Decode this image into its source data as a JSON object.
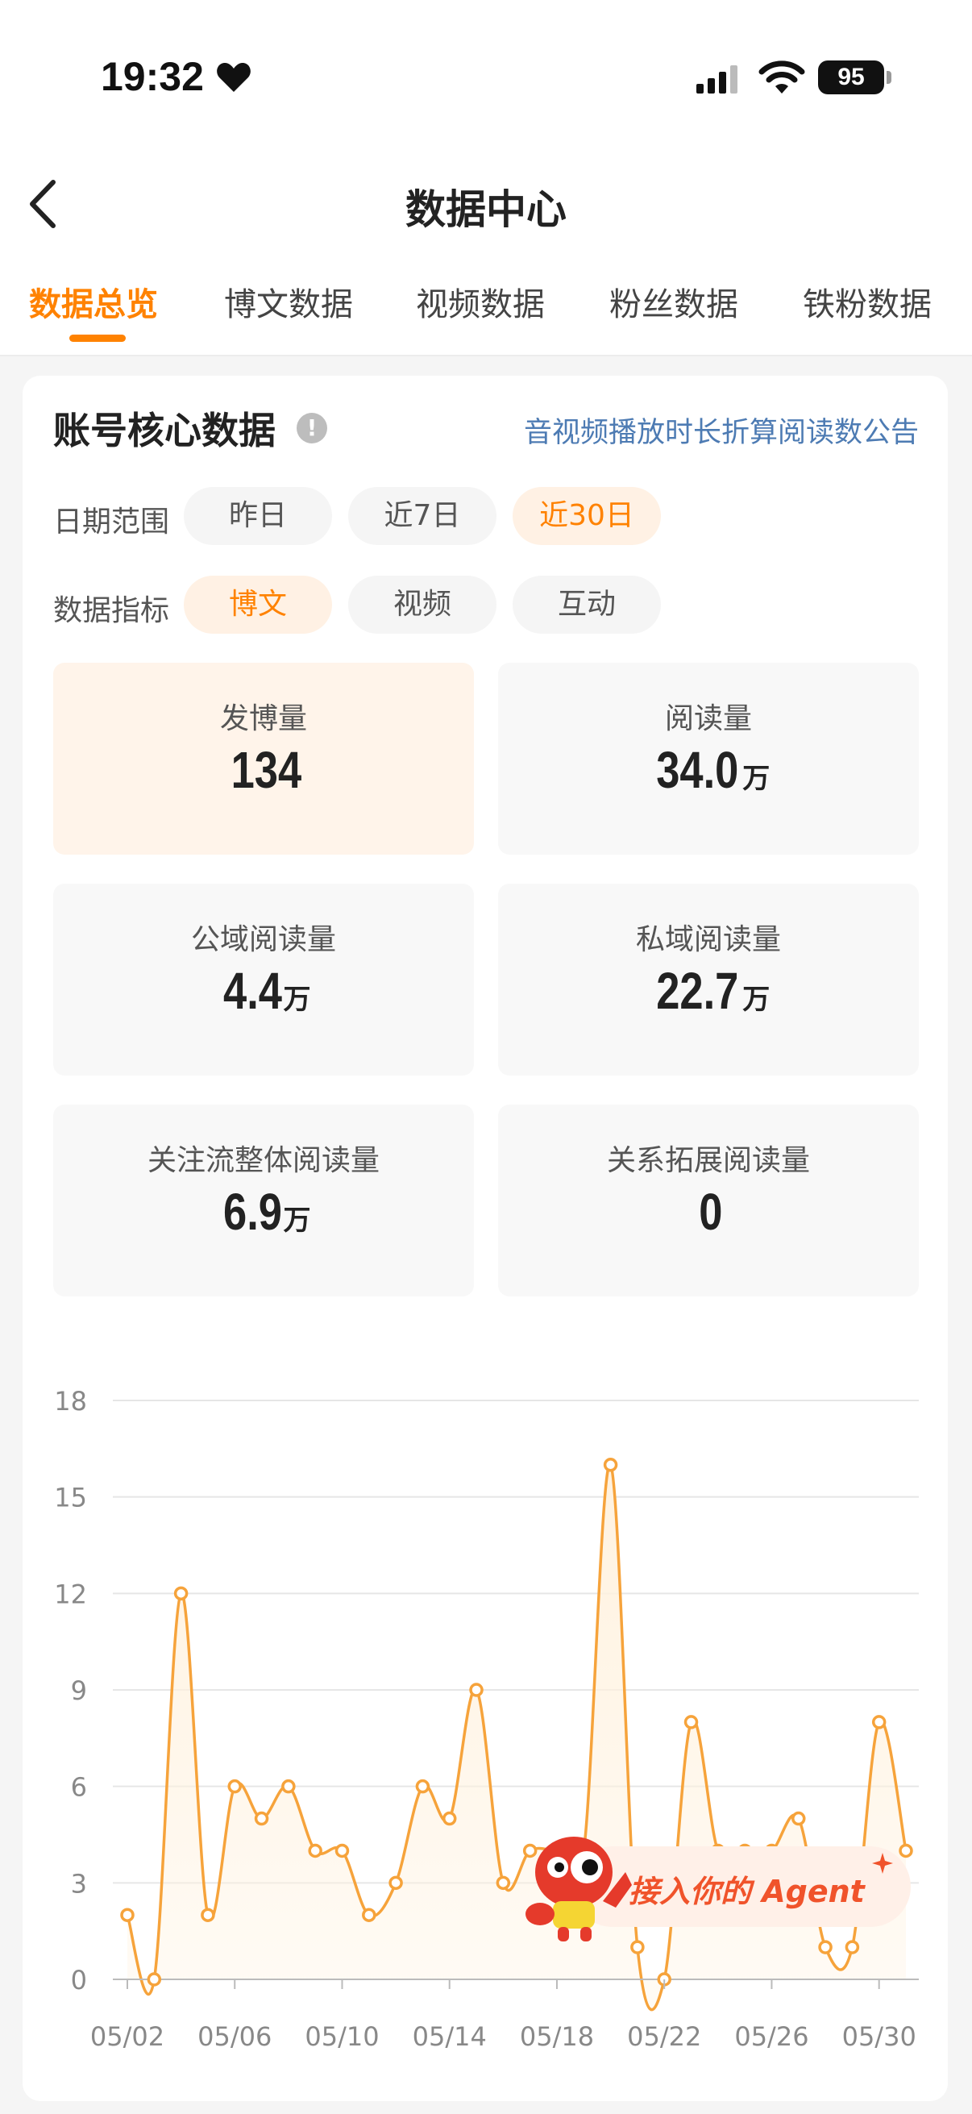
{
  "status_bar": {
    "time": "19:32",
    "battery": "95",
    "icons": [
      "heart-icon",
      "signal-icon",
      "wifi-icon",
      "battery-icon"
    ]
  },
  "header": {
    "title": "数据中心",
    "back_icon": "chevron-left-icon"
  },
  "tabs": [
    {
      "label": "数据总览",
      "active": true
    },
    {
      "label": "博文数据",
      "active": false
    },
    {
      "label": "视频数据",
      "active": false
    },
    {
      "label": "粉丝数据",
      "active": false
    },
    {
      "label": "铁粉数据",
      "active": false
    }
  ],
  "core": {
    "title": "账号核心数据",
    "info_icon": "!",
    "notice_link": "音视频播放时长折算阅读数公告",
    "date_range": {
      "label": "日期范围",
      "options": [
        "昨日",
        "近7日",
        "近30日"
      ],
      "selected": "近30日"
    },
    "metric_type": {
      "label": "数据指标",
      "options": [
        "博文",
        "视频",
        "互动"
      ],
      "selected": "博文"
    },
    "metrics": [
      {
        "label": "发博量",
        "value": "134",
        "unit": ""
      },
      {
        "label": "阅读量",
        "value": "34.0",
        "unit": "万"
      },
      {
        "label": "公域阅读量",
        "value": "4.4",
        "unit": "万"
      },
      {
        "label": "私域阅读量",
        "value": "22.7",
        "unit": "万"
      },
      {
        "label": "关注流整体阅读量",
        "value": "6.9",
        "unit": "万"
      },
      {
        "label": "关系拓展阅读量",
        "value": "0",
        "unit": ""
      }
    ]
  },
  "chart_data": {
    "type": "area",
    "x": [
      "05/02",
      "05/03",
      "05/04",
      "05/05",
      "05/06",
      "05/07",
      "05/08",
      "05/09",
      "05/10",
      "05/11",
      "05/12",
      "05/13",
      "05/14",
      "05/15",
      "05/16",
      "05/17",
      "05/18",
      "05/19",
      "05/20",
      "05/21",
      "05/22",
      "05/23",
      "05/24",
      "05/25",
      "05/26",
      "05/27",
      "05/28",
      "05/29",
      "05/30",
      "05/31"
    ],
    "values": [
      2,
      0,
      12,
      2,
      6,
      5,
      6,
      4,
      4,
      2,
      3,
      6,
      5,
      9,
      3,
      4,
      4,
      4,
      16,
      1,
      0,
      8,
      4,
      4,
      4,
      5,
      1,
      1,
      8,
      4
    ],
    "x_tick_labels": [
      "05/02",
      "05/06",
      "05/10",
      "05/14",
      "05/18",
      "05/22",
      "05/26",
      "05/30"
    ],
    "y_ticks": [
      0,
      3,
      6,
      9,
      12,
      15,
      18
    ],
    "ylim": [
      0,
      18
    ],
    "grid": true,
    "colors": {
      "line": "#f6a33b",
      "fill": "#fff2df",
      "grid": "#e6e6e6"
    }
  },
  "agent_badge": {
    "text": "接入你的 Agent",
    "mascot_icon": "mascot-icon",
    "sparkle_icon": "sparkle-icon"
  }
}
